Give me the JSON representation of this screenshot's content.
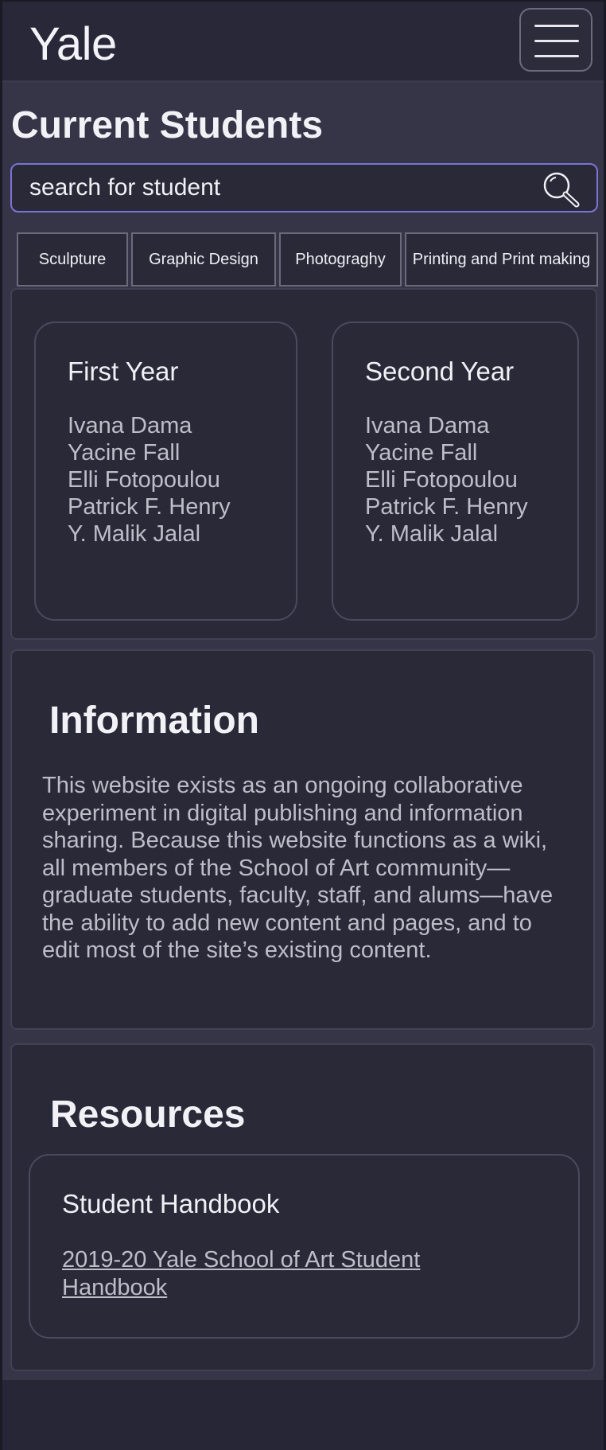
{
  "header": {
    "logo": "Yale",
    "menu_icon": "hamburger-menu-icon"
  },
  "page": {
    "title": "Current Students"
  },
  "search": {
    "placeholder": "search for student",
    "value": "",
    "icon": "search-icon"
  },
  "tabs": [
    {
      "label": "Sculpture"
    },
    {
      "label": "Graphic Design"
    },
    {
      "label": "Photograghy"
    },
    {
      "label": "Printing and Print making"
    }
  ],
  "years": [
    {
      "title": "First Year",
      "students": [
        "Ivana Dama",
        "Yacine Fall",
        "Elli Fotopoulou",
        "Patrick F. Henry",
        "Y. Malik Jalal"
      ]
    },
    {
      "title": "Second Year",
      "students": [
        "Ivana Dama",
        "Yacine Fall",
        "Elli Fotopoulou",
        "Patrick F. Henry",
        "Y. Malik Jalal"
      ]
    }
  ],
  "information": {
    "heading": "Information",
    "body": "This website exists as an ongoing collaborative experiment in digital publishing and information sharing. Because this website functions as a wiki, all members of the School of Art community—graduate students, faculty, staff, and alums—have the ability to add new content and pages, and to edit most of the site’s existing content."
  },
  "resources": {
    "heading": "Resources",
    "card_title": "Student Handbook",
    "link_text": "2019-20 Yale School of Art Student Handbook"
  },
  "colors": {
    "background": "#272636",
    "panel": "#363548",
    "card": "#2a2938",
    "accent": "#7a74d4",
    "text": "#f2f1f6",
    "muted_text": "#bebdc8"
  }
}
